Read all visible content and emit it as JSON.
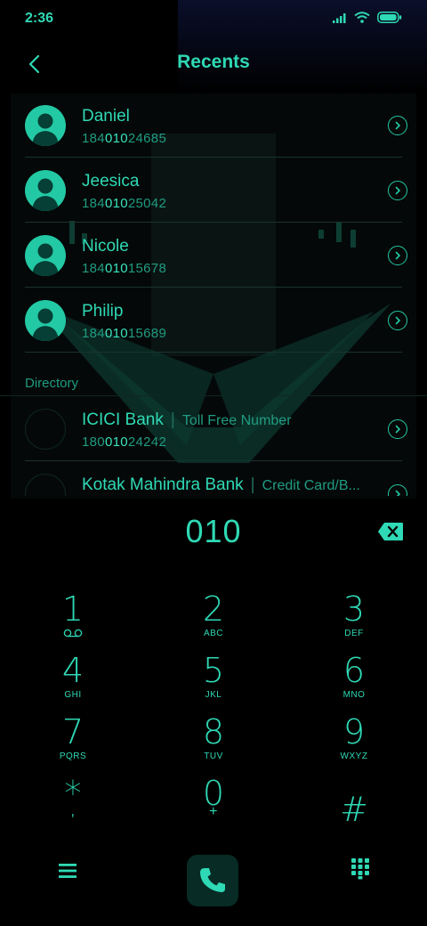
{
  "status_bar": {
    "time": "2:36",
    "icons": [
      "signal-icon",
      "wifi-icon",
      "battery-icon"
    ]
  },
  "header": {
    "title": "Recents",
    "back_icon": "chevron-left-icon"
  },
  "recents": [
    {
      "name": "Daniel",
      "number_prefix": "184",
      "number_match": "010",
      "number_suffix": "24685"
    },
    {
      "name": "Jeesica",
      "number_prefix": "184",
      "number_match": "010",
      "number_suffix": "25042"
    },
    {
      "name": "Nicole",
      "number_prefix": "184",
      "number_match": "010",
      "number_suffix": "15678"
    },
    {
      "name": "Philip",
      "number_prefix": "184",
      "number_match": "010",
      "number_suffix": "15689"
    }
  ],
  "directory": {
    "label": "Directory",
    "items": [
      {
        "name": "ICICI Bank",
        "tag": "Toll Free Number",
        "number_prefix": "180",
        "number_match": "010",
        "number_suffix": "24242"
      },
      {
        "name": "Kotak Mahindra Bank",
        "tag": "Credit Card/B...",
        "number_prefix": "",
        "number_match": "",
        "number_suffix": ""
      }
    ]
  },
  "dialer": {
    "input": "010",
    "backspace_icon": "backspace-icon",
    "keys": [
      {
        "digit": "1",
        "letters": "voicemail"
      },
      {
        "digit": "2",
        "letters": "ABC"
      },
      {
        "digit": "3",
        "letters": "DEF"
      },
      {
        "digit": "4",
        "letters": "GHI"
      },
      {
        "digit": "5",
        "letters": "JKL"
      },
      {
        "digit": "6",
        "letters": "MNO"
      },
      {
        "digit": "7",
        "letters": "PQRS"
      },
      {
        "digit": "8",
        "letters": "TUV"
      },
      {
        "digit": "9",
        "letters": "WXYZ"
      },
      {
        "digit": "*",
        "letters": ","
      },
      {
        "digit": "0",
        "letters": "+"
      },
      {
        "digit": "#",
        "letters": ""
      }
    ]
  },
  "bottom_bar": {
    "left_icon": "menu-icon",
    "center_icon": "phone-icon",
    "right_icon": "dialpad-icon"
  },
  "colors": {
    "accent": "#2fd9b5",
    "dim": "#1f9c82",
    "background": "#000000"
  }
}
